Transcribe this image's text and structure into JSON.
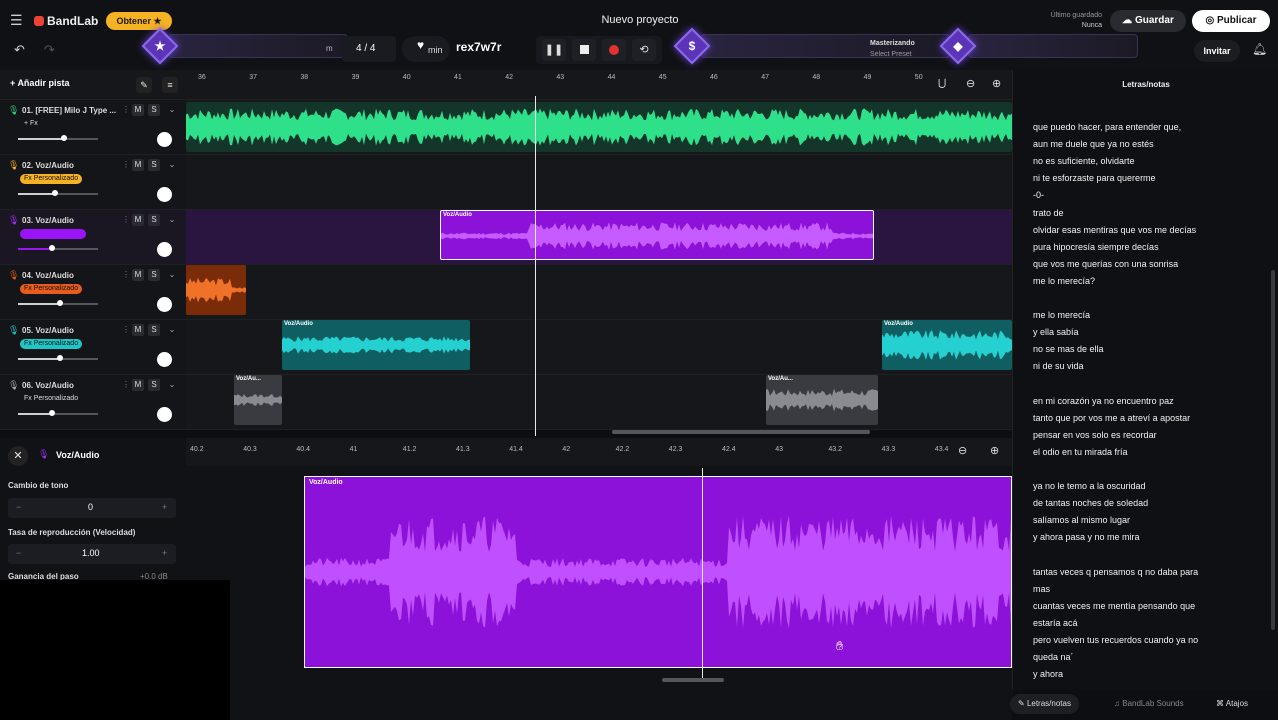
{
  "header": {
    "app_name": "BandLab",
    "obtain_label": "Obtener",
    "obtain_star": "★",
    "project_title": "Nuevo proyecto",
    "time_signature": "4 / 4",
    "bpm_unit": "min",
    "key_code": "rex7w7r",
    "mastering_label": "Masterizando",
    "preset_label": "Select Preset",
    "saved_status": "Último guardado",
    "saved_time": "Nunca",
    "save_label": "Guardar",
    "publish_label": "Publicar",
    "invite_label": "Invitar",
    "star_glyph": "★",
    "dollar_glyph": "$",
    "diamond_glyph": "◆",
    "mixer_caret": "m"
  },
  "tracks_toolbar": {
    "add_track_label": "Añadir pista"
  },
  "tracks": [
    {
      "title": "01. [FREE] Milo J Type ...",
      "fx": "+ Fx",
      "fx_color": "",
      "icon_color": "#2fd47d",
      "volume": 0.58
    },
    {
      "title": "02. Voz/Audio",
      "fx": "Fx Personalizado",
      "fx_color": "#f5b323",
      "icon_color": "#f5b323",
      "volume": 0.46
    },
    {
      "title": "03. Voz/Audio",
      "fx": "",
      "fx_color": "#9b14f5",
      "icon_color": "#a32cff",
      "volume": 0.42
    },
    {
      "title": "04. Voz/Audio",
      "fx": "Fx Personalizado",
      "fx_color": "#e85c1c",
      "icon_color": "#e85c1c",
      "volume": 0.52
    },
    {
      "title": "05. Voz/Audio",
      "fx": "Fx Personalizado",
      "fx_color": "#1ec6c6",
      "icon_color": "#1ec6c6",
      "volume": 0.52
    },
    {
      "title": "06. Voz/Audio",
      "fx": "Fx Personalizado",
      "fx_color": "",
      "icon_color": "#aaaaaa",
      "volume": 0.42
    }
  ],
  "timeline": {
    "ticks": [
      "36",
      "37",
      "38",
      "39",
      "40",
      "41",
      "42",
      "43",
      "44",
      "45",
      "46",
      "47",
      "48",
      "49",
      "50"
    ]
  },
  "clips": {
    "voz_label": "Voz/Audio",
    "short_label": "Voz/Au..."
  },
  "editor": {
    "track_label": "Voz/Audio",
    "pitch_label": "Cambio de tono",
    "pitch_value": "0",
    "rate_label": "Tasa de reproducción (Velocidad)",
    "rate_value": "1.00",
    "gain_label": "Ganancia del paso",
    "gain_value": "+0.0 dB",
    "clip_label": "Voz/Audio",
    "ruler": [
      "40.2",
      "40.3",
      "40.4",
      "41",
      "41.2",
      "41.3",
      "41.4",
      "42",
      "42.2",
      "42.3",
      "42.4",
      "43",
      "43.2",
      "43.3",
      "43.4"
    ]
  },
  "lyrics": {
    "title": "Letras/notas",
    "lines": [
      "que puedo hacer, para entender que,",
      "aun me duele que ya no estés",
      "no es suficiente, olvidarte",
      "ni te esforzaste para quererme",
      "-0-",
      "trato de",
      "olvidar esas mentiras que vos me decías",
      "pura hipocresía siempre decías",
      "que vos me querías con una sonrisa",
      "me lo merecía?",
      "",
      "me lo merecía",
      "y ella sabía",
      "no se mas de ella",
      "ni de su vida",
      "",
      "  en mi corazón ya no encuentro paz",
      "tanto que por vos me a  atreví a apostar",
      "pensar en vos solo es recordar",
      "el odio en tu mirada fría",
      "",
      "ya no le temo a la oscuridad",
      "de tantas noches de soledad",
      "salíamos al mismo lugar",
      "y ahora pasa y no me mira",
      "",
      "tantas veces q pensamos q no daba para",
      "mas",
      "cuantas  veces me mentía pensando que",
      "estaría acá",
      "pero vuelven tus recuerdos cuando ya no",
      "queda na´",
      "y ahora"
    ]
  },
  "bottom_tabs": {
    "lyrics": "Letras/notas",
    "sounds": "BandLab Sounds",
    "shortcuts": "Atajos"
  }
}
